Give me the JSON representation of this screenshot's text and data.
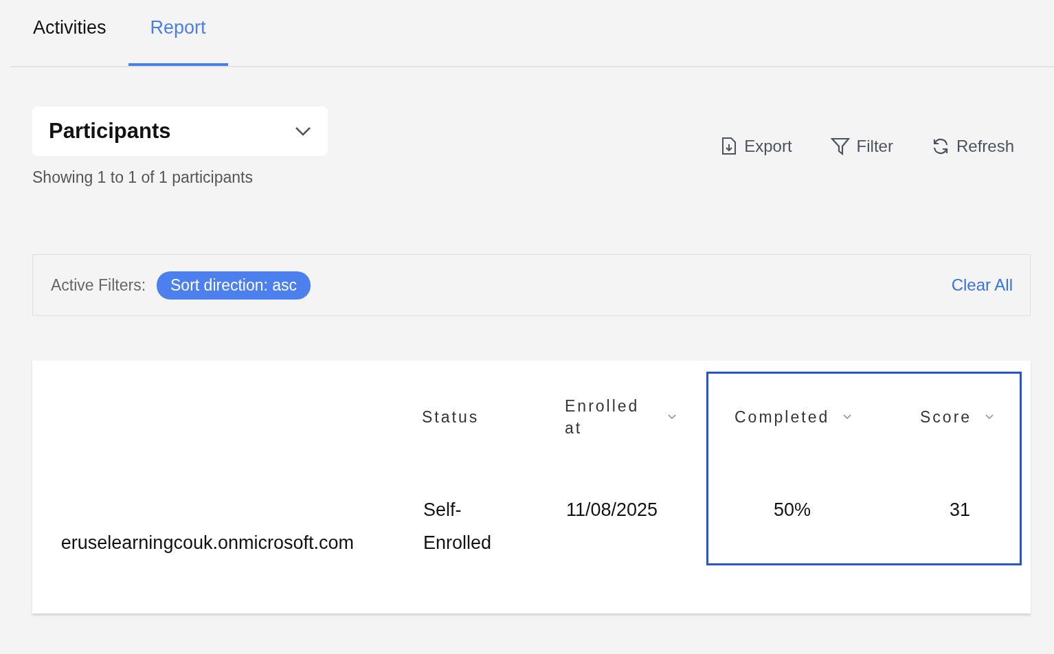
{
  "tabs": [
    {
      "label": "Activities",
      "selected": false
    },
    {
      "label": "Report",
      "selected": true
    }
  ],
  "view_select": {
    "value": "Participants"
  },
  "summary": "Showing 1 to 1 of 1 participants",
  "toolbar": [
    {
      "kind": "export",
      "label": "Export"
    },
    {
      "kind": "filter",
      "label": "Filter"
    },
    {
      "kind": "refresh",
      "label": "Refresh"
    }
  ],
  "active_filters": {
    "label": "Active Filters:",
    "chips": [
      "Sort direction: asc"
    ],
    "clear": "Clear All"
  },
  "table": {
    "columns": [
      {
        "sortable": false,
        "highlighted": false
      },
      {
        "label": "Status",
        "sortable": false,
        "highlighted": false
      },
      {
        "label": "Enrolled at",
        "sortable": true,
        "highlighted": false
      },
      {
        "label": "Completed",
        "sortable": true,
        "highlighted": true
      },
      {
        "label": "Score",
        "sortable": true,
        "highlighted": true
      }
    ],
    "rows": [
      [
        "eruselearningcouk.onmicrosoft.com",
        "Self-Enrolled",
        "11/08/2025",
        "50%",
        "31"
      ]
    ]
  }
}
